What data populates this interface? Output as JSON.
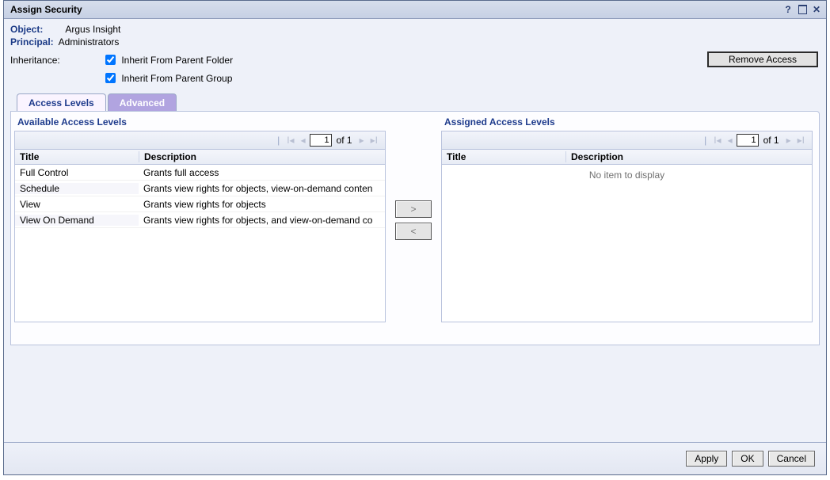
{
  "title": "Assign Security",
  "meta": {
    "object_label": "Object:",
    "object_value": "Argus Insight",
    "principal_label": "Principal:",
    "principal_value": "Administrators"
  },
  "inheritance": {
    "label": "Inheritance:",
    "opt_folder": "Inherit From Parent Folder",
    "opt_group": "Inherit From Parent Group",
    "folder_checked": true,
    "group_checked": true
  },
  "buttons": {
    "remove_access": "Remove Access",
    "apply": "Apply",
    "ok": "OK",
    "cancel": "Cancel"
  },
  "tabs": {
    "access_levels": "Access Levels",
    "advanced": "Advanced"
  },
  "available": {
    "heading": "Available Access Levels",
    "page_value": "1",
    "page_total_label": "of 1",
    "col_title": "Title",
    "col_desc": "Description",
    "rows": [
      {
        "title": "Full Control",
        "desc": "Grants full access"
      },
      {
        "title": "Schedule",
        "desc": "Grants view rights for objects, view-on-demand conten"
      },
      {
        "title": "View",
        "desc": "Grants view rights for objects"
      },
      {
        "title": "View On Demand",
        "desc": "Grants view rights for objects, and view-on-demand co"
      }
    ]
  },
  "assigned": {
    "heading": "Assigned Access Levels",
    "page_value": "1",
    "page_total_label": "of 1",
    "col_title": "Title",
    "col_desc": "Description",
    "empty": "No item to display"
  },
  "nav_glyphs": {
    "first": "⏮",
    "prev": "◀",
    "next": "▶",
    "last": "⏭"
  },
  "transfer": {
    "right": ">",
    "left": "<"
  }
}
